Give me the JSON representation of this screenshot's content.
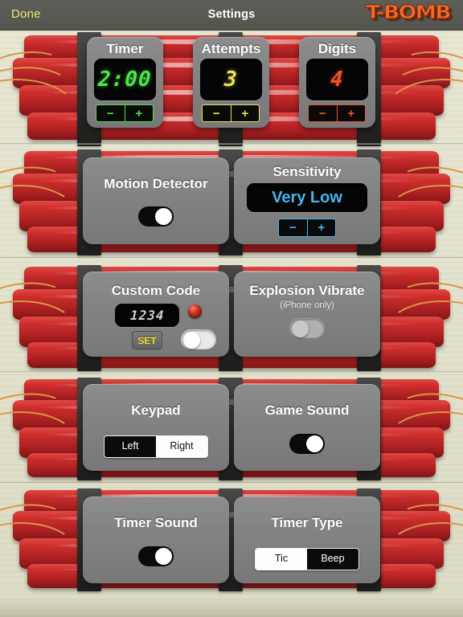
{
  "header": {
    "done_label": "Done",
    "title": "Settings",
    "logo": "T-BOMB",
    "done_color": "#e8e86a"
  },
  "rows": {
    "row1": {
      "timer": {
        "title": "Timer",
        "value": "2:00",
        "color": "#4ee24e",
        "minus": "−",
        "plus": "+"
      },
      "attempts": {
        "title": "Attempts",
        "value": "3",
        "color": "#ece05a",
        "minus": "−",
        "plus": "+"
      },
      "digits": {
        "title": "Digits",
        "value": "4",
        "color": "#f1502a",
        "minus": "−",
        "plus": "+"
      }
    },
    "row2": {
      "motion": {
        "title": "Motion Detector",
        "toggle_state": "on"
      },
      "sensitivity": {
        "title": "Sensitivity",
        "value": "Very Low",
        "color": "#43b6f0",
        "minus": "−",
        "plus": "+"
      }
    },
    "row3": {
      "custom_code": {
        "title": "Custom Code",
        "value": "1234",
        "color": "#cfcfcf",
        "set_label": "SET",
        "toggle_state": "off",
        "led": "led-indicator"
      },
      "explosion_vibrate": {
        "title": "Explosion Vibrate",
        "subtitle": "(iPhone only)",
        "toggle_state": "disabled"
      }
    },
    "row4": {
      "keypad": {
        "title": "Keypad",
        "options": [
          "Left",
          "Right"
        ],
        "selected": "Left"
      },
      "game_sound": {
        "title": "Game Sound",
        "toggle_state": "on"
      }
    },
    "row5": {
      "timer_sound": {
        "title": "Timer Sound",
        "toggle_state": "on"
      },
      "timer_type": {
        "title": "Timer Type",
        "options": [
          "Tic",
          "Beep"
        ],
        "selected": "Beep"
      }
    }
  }
}
